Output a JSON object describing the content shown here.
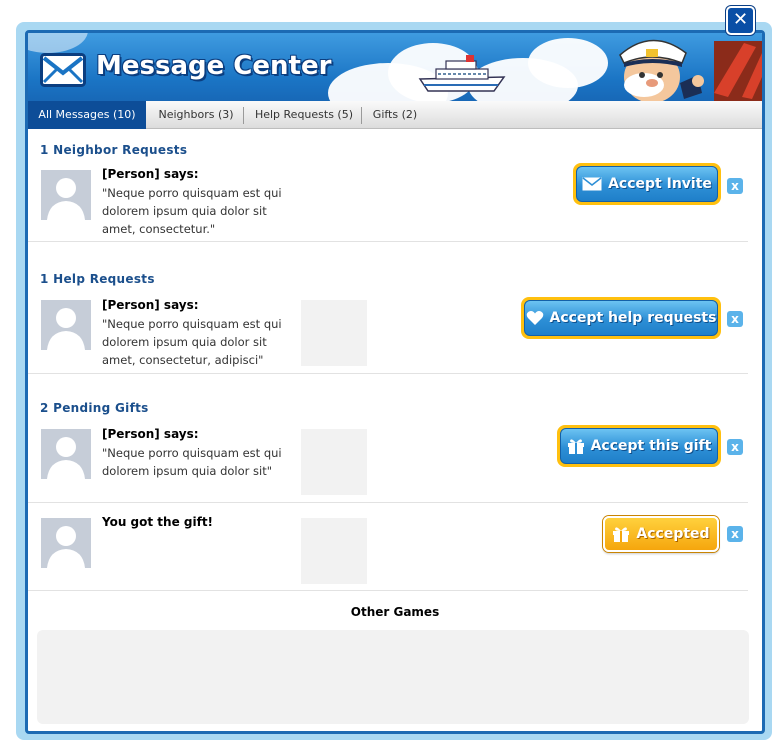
{
  "window": {
    "title": "Message Center",
    "close_label": "✕"
  },
  "tabs": [
    {
      "label": "All Messages (10)"
    },
    {
      "label": "Neighbors (3)"
    },
    {
      "label": "Help Requests (5)"
    },
    {
      "label": "Gifts (2)"
    }
  ],
  "sections": {
    "neighbors": {
      "title": "1 Neighbor Requests",
      "person": "[Person] says:",
      "quote": "\"Neque porro quisquam est qui dolorem ipsum quia dolor sit amet, consectetur.\"",
      "button": "Accept Invite"
    },
    "help": {
      "title": "1 Help Requests",
      "person": "[Person] says:",
      "quote": "\"Neque porro quisquam est qui dolorem ipsum quia dolor sit amet, consectetur, adipisci\"",
      "button": "Accept help requests"
    },
    "gifts": {
      "title": "2 Pending Gifts",
      "items": [
        {
          "person": "[Person] says:",
          "quote": "\"Neque porro quisquam est qui dolorem ipsum quia dolor sit\"",
          "button": "Accept this gift"
        },
        {
          "person": "You got the gift!",
          "button": "Accepted"
        }
      ]
    }
  },
  "dismiss_label": "x",
  "other_games": {
    "title": "Other Games"
  },
  "colors": {
    "accent_blue": "#1c6ab3",
    "button_glow": "#ffc00f",
    "accepted_orange": "#f5a60d",
    "section_title": "#1b4f8c"
  }
}
